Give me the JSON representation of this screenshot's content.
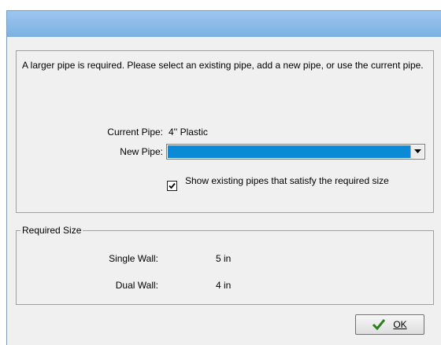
{
  "dialog": {
    "message": "A larger pipe is required. Please select an existing pipe, add a new pipe, or use the current pipe.",
    "current_pipe_label": "Current Pipe:",
    "current_pipe_value": "4'' Plastic",
    "new_pipe_label": "New Pipe:",
    "new_pipe_value": "",
    "show_existing_label": "Show existing pipes that satisfy the required size",
    "show_existing_checked": true,
    "required_size": {
      "title": "Required Size",
      "single_wall_label": "Single Wall:",
      "single_wall_value": "5  in",
      "dual_wall_label": "Dual Wall:",
      "dual_wall_value": "4  in"
    },
    "ok_label": "OK"
  },
  "colors": {
    "title_bar": "#7cb0e2",
    "selection": "#0d8ad6",
    "check_icon": "#2e7d1f"
  },
  "icons": {
    "dropdown": "chevron-down-icon",
    "checkbox": "checkmark-icon",
    "ok": "green-check-icon"
  }
}
